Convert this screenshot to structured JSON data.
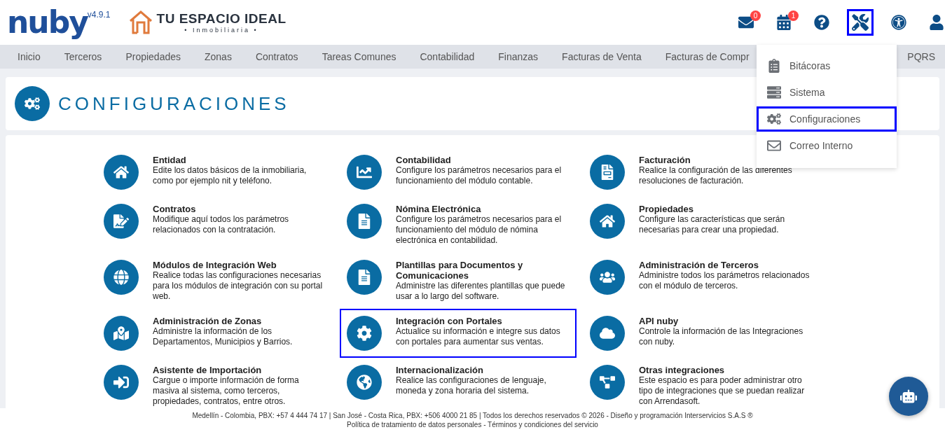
{
  "header": {
    "logo": "nuby",
    "version": "v4.9.1",
    "brand": {
      "name": "TU ESPACIO IDEAL",
      "tagline": "• Inmobiliaria •"
    },
    "icons": [
      {
        "kind": "mail",
        "badge": "0",
        "highlighted": false
      },
      {
        "kind": "calendar",
        "badge": "1",
        "highlighted": false
      },
      {
        "kind": "help",
        "highlighted": false
      },
      {
        "kind": "tools",
        "highlighted": true
      },
      {
        "kind": "accessibility",
        "highlighted": false
      },
      {
        "kind": "user",
        "highlighted": false
      }
    ]
  },
  "nav": [
    "Inicio",
    "Terceros",
    "Propiedades",
    "Zonas",
    "Contratos",
    "Tareas Comunes",
    "Contabilidad",
    "Finanzas",
    "Facturas de Venta",
    "Facturas de Compr",
    "PQRS"
  ],
  "tools_menu": [
    {
      "label": "Bitácoras",
      "highlighted": false
    },
    {
      "label": "Sistema",
      "highlighted": false
    },
    {
      "label": "Configuraciones",
      "highlighted": true
    },
    {
      "label": "Correo Interno",
      "highlighted": false
    }
  ],
  "page_title": "CONFIGURACIONES",
  "modules": [
    {
      "title": "Entidad",
      "description": "Edite los datos básicos de la inmobiliaria, como por ejemplo nit y teléfono.",
      "highlighted": false
    },
    {
      "title": "Contabilidad",
      "description": "Configure los parámetros necesarios para el funcionamiento del módulo contable.",
      "highlighted": false
    },
    {
      "title": "Facturación",
      "description": "Realice la configuración de las diferentes resoluciones de facturación.",
      "highlighted": false
    },
    {
      "title": "Contratos",
      "description": "Modifique aquí todos los parámetros relacionados con la contratación.",
      "highlighted": false
    },
    {
      "title": "Nómina Electrónica",
      "description": "Configure los parámetros necesarios para el funcionamiento del módulo de nómina electrónica en contabilidad.",
      "highlighted": false
    },
    {
      "title": "Propiedades",
      "description": "Configure las características que serán necesarias para crear una propiedad.",
      "highlighted": false
    },
    {
      "title": "Módulos de Integración Web",
      "description": "Realice todas las configuraciones necesarias para los módulos de integración con su portal web.",
      "highlighted": false
    },
    {
      "title": "Plantillas para Documentos y Comunicaciones",
      "description": "Administre las diferentes plantillas que puede usar a lo largo del software.",
      "highlighted": false
    },
    {
      "title": "Administración de Terceros",
      "description": "Administre todos los parámetros relacionados con el módulo de terceros.",
      "highlighted": false
    },
    {
      "title": "Administración de Zonas",
      "description": "Administre la información de los Departamentos, Municipios y Barrios.",
      "highlighted": false
    },
    {
      "title": "Integración con Portales",
      "description": "Actualice su información e integre sus datos con portales para aumentar sus ventas.",
      "highlighted": true
    },
    {
      "title": "API nuby",
      "description": "Controle la información de las Integraciones con nuby.",
      "highlighted": false
    },
    {
      "title": "Asistente de Importación",
      "description": "Cargue o importe información de forma masiva al sistema, como terceros, propiedades, contratos, entre otros.",
      "highlighted": false
    },
    {
      "title": "Internacionalización",
      "description": "Realice las configuraciones de lenguaje, moneda y zona horaria del sistema.",
      "highlighted": false
    },
    {
      "title": "Otras integraciones",
      "description": "Este espacio es para poder administrar otro tipo de integraciones que se puedan realizar con Arrendasoft.",
      "highlighted": false
    }
  ],
  "footer": [
    "Medellín - Colombia, PBX: +57 4 444 74 17 | San José - Costa Rica, PBX: +506 4000 21 85 | Todos los derechos reservados © 2026 - Diseño y programación Interservicios S.A.S ®",
    "Política de tratamiento de datos personales - Términos y condiciones del servicio"
  ]
}
